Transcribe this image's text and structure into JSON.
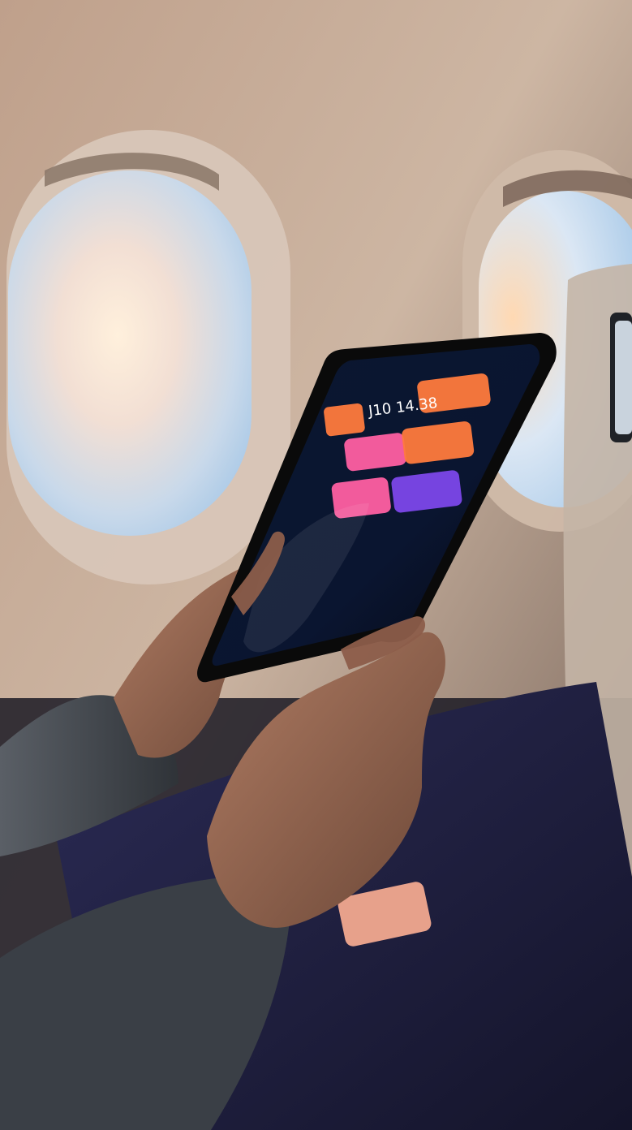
{
  "scene": {
    "subject": "hands-holding-tablet-airplane-window",
    "colors": {
      "cabin_wall": "#cdb6a3",
      "cabin_shadow": "#6f5c52",
      "sky_top": "#9fc4e6",
      "sky_glow": "#ffd9b3",
      "tablet_screen": "#0b1730",
      "tile_orange": "#ff7a3d",
      "tile_pink": "#ff5fa2",
      "tile_purple": "#8a4cff",
      "lap_case": "#2b2b55",
      "case_tab": "#e7a18b",
      "sleeve": "#5a5f66",
      "skin": "#9b6f58"
    }
  },
  "tablet": {
    "time_text": "J10 14.38"
  }
}
